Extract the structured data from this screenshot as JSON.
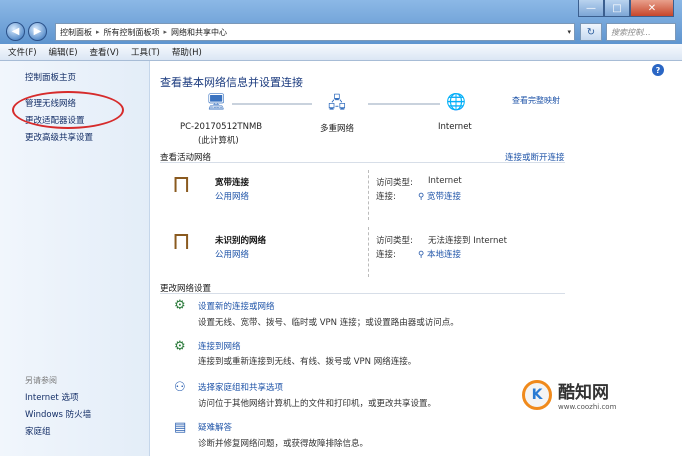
{
  "window": {
    "minimize": "—",
    "maximize": "□",
    "close": "✕"
  },
  "nav": {
    "back": "◀",
    "forward": "▶"
  },
  "address": {
    "crumbs": [
      "控制面板",
      "所有控制面板项",
      "网络和共享中心"
    ],
    "sep": "▸",
    "dropdown": "▾",
    "refresh": "↻",
    "search_placeholder": "搜索控制..."
  },
  "menu": [
    "文件(F)",
    "编辑(E)",
    "查看(V)",
    "工具(T)",
    "帮助(H)"
  ],
  "sidebar": {
    "home": "控制面板主页",
    "items": [
      "管理无线网络",
      "更改适配器设置",
      "更改高级共享设置"
    ],
    "see_also_head": "另请参阅",
    "see_also": [
      "Internet 选项",
      "Windows 防火墙",
      "家庭组"
    ]
  },
  "main": {
    "title": "查看基本网络信息并设置连接",
    "view_map": "查看完整映射",
    "nodes": [
      {
        "icon": "computer-icon",
        "label": "PC-20170512TNMB",
        "sub": "(此计算机)"
      },
      {
        "icon": "multi-network-icon",
        "label": "多重网络",
        "sub": ""
      },
      {
        "icon": "globe-icon",
        "label": "Internet",
        "sub": ""
      }
    ],
    "active_title": "查看活动网络",
    "connect_link": "连接或断开连接",
    "networks": [
      {
        "name": "宽带连接",
        "type": "公用网络",
        "access_label": "访问类型:",
        "access": "Internet",
        "conn_label": "连接:",
        "conn": "宽带连接"
      },
      {
        "name": "未识别的网络",
        "type": "公用网络",
        "access_label": "访问类型:",
        "access": "无法连接到 Internet",
        "conn_label": "连接:",
        "conn": "本地连接"
      }
    ],
    "change_title": "更改网络设置",
    "tasks": [
      {
        "title": "设置新的连接或网络",
        "desc": "设置无线、宽带、拨号、临时或 VPN 连接；或设置路由器或访问点。"
      },
      {
        "title": "连接到网络",
        "desc": "连接到或重新连接到无线、有线、拨号或 VPN 网络连接。"
      },
      {
        "title": "选择家庭组和共享选项",
        "desc": "访问位于其他网络计算机上的文件和打印机，或更改共享设置。"
      },
      {
        "title": "疑难解答",
        "desc": "诊断并修复网络问题，或获得故障排除信息。"
      }
    ]
  },
  "watermark": {
    "logo": "K",
    "name": "酷知网",
    "url": "www.coozhi.com"
  },
  "colors": {
    "link": "#1f54a8",
    "highlight_circle": "#d62b2b",
    "accent": "#f08a1c"
  }
}
